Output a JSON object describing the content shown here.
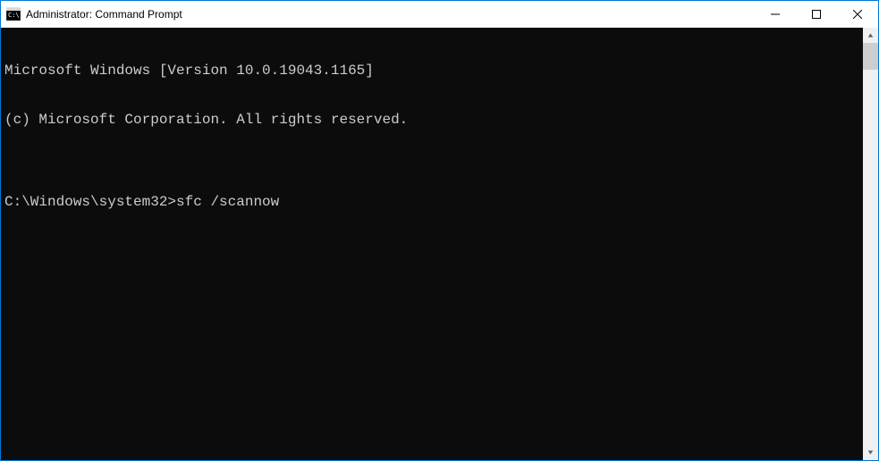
{
  "window": {
    "title": "Administrator: Command Prompt"
  },
  "terminal": {
    "line1": "Microsoft Windows [Version 10.0.19043.1165]",
    "line2": "(c) Microsoft Corporation. All rights reserved.",
    "blank": "",
    "prompt": "C:\\Windows\\system32>",
    "command": "sfc /scannow"
  }
}
